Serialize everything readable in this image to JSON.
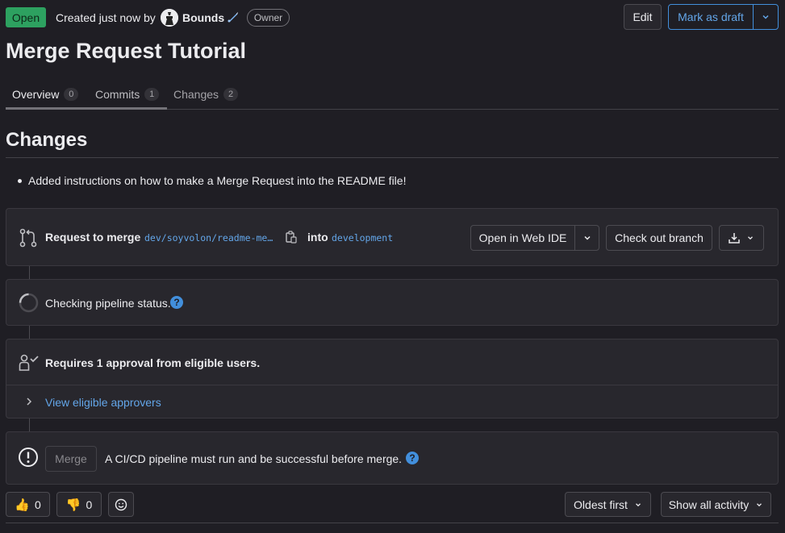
{
  "header": {
    "status": "Open",
    "created_text": "Created just now by",
    "author": "Bounds",
    "role_badge": "Owner",
    "edit_label": "Edit",
    "draft_label": "Mark as draft",
    "title": "Merge Request Tutorial"
  },
  "tabs": [
    {
      "label": "Overview",
      "count": "0"
    },
    {
      "label": "Commits",
      "count": "1"
    },
    {
      "label": "Changes",
      "count": "2"
    }
  ],
  "description": {
    "heading": "Changes",
    "bullet": "Added instructions on how to make a Merge Request into the README file!"
  },
  "merge_info": {
    "request_label": "Request to merge",
    "source_branch": "dev/soyvolon/readme-me…",
    "into_label": "into",
    "target_branch": "development",
    "web_ide_label": "Open in Web IDE",
    "checkout_label": "Check out branch"
  },
  "pipeline": {
    "status_text": "Checking pipeline status."
  },
  "approvals": {
    "text": "Requires 1 approval from eligible users.",
    "view_label": "View eligible approvers"
  },
  "merge": {
    "button_label": "Merge",
    "notice": "A CI/CD pipeline must run and be successful before merge."
  },
  "reactions": {
    "thumbs_up": "0",
    "thumbs_down": "0"
  },
  "activity": {
    "sort_label": "Oldest first",
    "filter_label": "Show all activity"
  },
  "colors": {
    "open_badge": "#2da160",
    "link": "#63a6e9",
    "background": "#1f1e24",
    "panel": "#28272d"
  }
}
